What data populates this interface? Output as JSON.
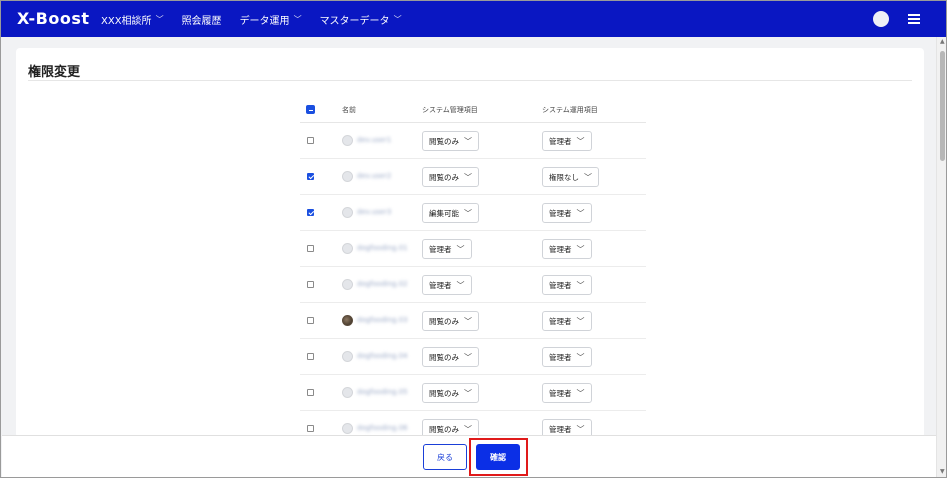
{
  "app": {
    "logo": "X-Boost",
    "nav": [
      {
        "label": "XXX相談所",
        "dropdown": true
      },
      {
        "label": "照会履歴",
        "dropdown": false
      },
      {
        "label": "データ運用",
        "dropdown": true
      },
      {
        "label": "マスターデータ",
        "dropdown": true
      }
    ]
  },
  "page": {
    "title": "権限変更"
  },
  "table": {
    "headers": {
      "name": "名前",
      "system_admin": "システム管理項目",
      "system_ops": "システム運用項目"
    },
    "rows": [
      {
        "checked": false,
        "avatar": "placeholder",
        "name": "dev.user1",
        "system_admin": "閲覧のみ",
        "system_ops": "管理者"
      },
      {
        "checked": true,
        "avatar": "placeholder",
        "name": "dev.user2",
        "system_admin": "閲覧のみ",
        "system_ops": "権限なし"
      },
      {
        "checked": true,
        "avatar": "placeholder",
        "name": "dev.user3",
        "system_admin": "編集可能",
        "system_ops": "管理者"
      },
      {
        "checked": false,
        "avatar": "placeholder",
        "name": "dogfooding.01",
        "system_admin": "管理者",
        "system_ops": "管理者"
      },
      {
        "checked": false,
        "avatar": "placeholder",
        "name": "dogfooding.02",
        "system_admin": "管理者",
        "system_ops": "管理者"
      },
      {
        "checked": false,
        "avatar": "photo",
        "name": "dogfooding.03",
        "system_admin": "閲覧のみ",
        "system_ops": "管理者"
      },
      {
        "checked": false,
        "avatar": "placeholder",
        "name": "dogfooding.04",
        "system_admin": "閲覧のみ",
        "system_ops": "管理者"
      },
      {
        "checked": false,
        "avatar": "placeholder",
        "name": "dogfooding.05",
        "system_admin": "閲覧のみ",
        "system_ops": "管理者"
      },
      {
        "checked": false,
        "avatar": "placeholder",
        "name": "dogfooding.06",
        "system_admin": "閲覧のみ",
        "system_ops": "管理者"
      }
    ]
  },
  "footer": {
    "back_label": "戻る",
    "confirm_label": "確認"
  },
  "colors": {
    "nav_bg": "#0a17c2",
    "primary": "#0b2fe6",
    "highlight": "#e01a1a"
  },
  "icons": {
    "dropdown": "chevron-down-icon",
    "menu": "hamburger-menu-icon",
    "avatar": "user-avatar-icon"
  }
}
